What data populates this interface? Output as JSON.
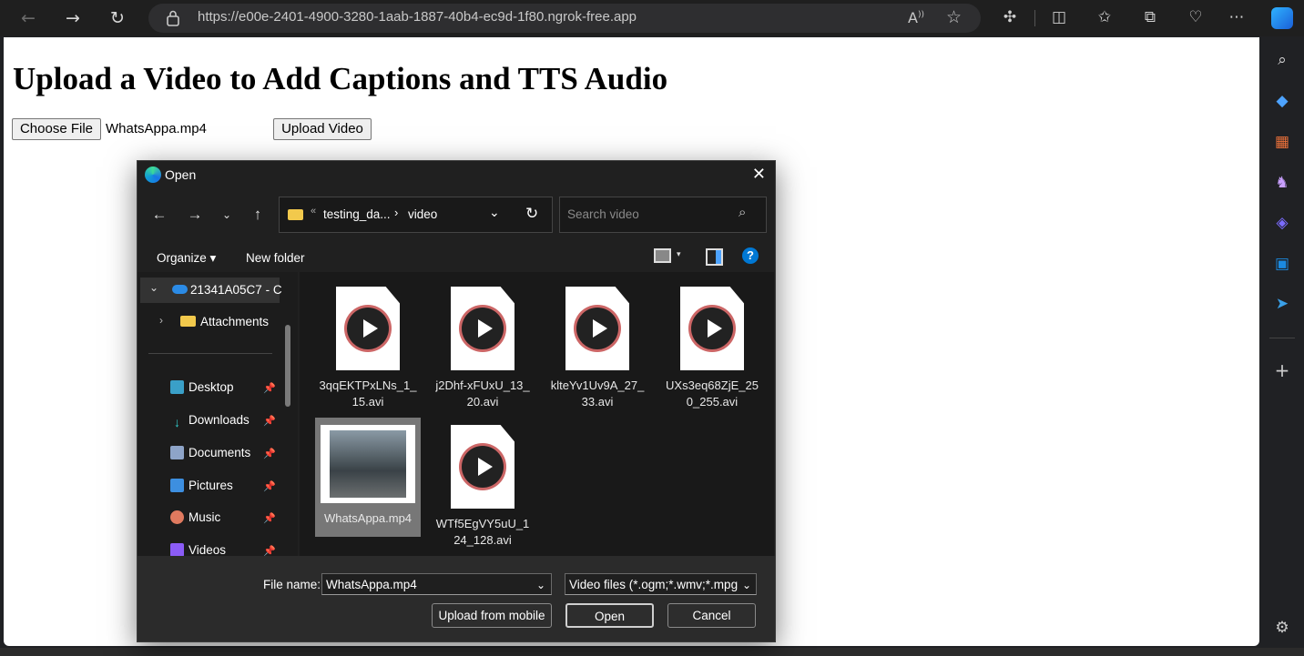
{
  "browser": {
    "url": "https://e00e-2401-4900-3280-1aab-1887-40b4-ec9d-1f80.ngrok-free.app"
  },
  "page": {
    "title": "Upload a Video to Add Captions and TTS Audio",
    "choose_file_label": "Choose File",
    "chosen_file": "WhatsAppa.mp4",
    "upload_button": "Upload Video"
  },
  "dialog": {
    "title": "Open",
    "path": {
      "parent": "testing_da...",
      "current": "video"
    },
    "search_placeholder": "Search video",
    "organize": "Organize",
    "new_folder": "New folder",
    "nav": {
      "onedrive": "21341A05C7 - C",
      "attachments": "Attachments",
      "desktop": "Desktop",
      "downloads": "Downloads",
      "documents": "Documents",
      "pictures": "Pictures",
      "music": "Music",
      "videos": "Videos"
    },
    "files": [
      {
        "line1": "3qqEKTPxLNs_1_",
        "line2": "15.avi"
      },
      {
        "line1": "j2Dhf-xFUxU_13_",
        "line2": "20.avi"
      },
      {
        "line1": "klteYv1Uv9A_27_",
        "line2": "33.avi"
      },
      {
        "line1": "UXs3eq68ZjE_25",
        "line2": "0_255.avi"
      },
      {
        "line1": "WhatsAppa.mp4",
        "line2": ""
      },
      {
        "line1": "WTf5EgVY5uU_1",
        "line2": "24_128.avi"
      }
    ],
    "file_name_label": "File name:",
    "file_name_value": "WhatsAppa.mp4",
    "file_type": "Video files (*.ogm;*.wmv;*.mpg",
    "upload_mobile": "Upload from mobile",
    "open": "Open",
    "cancel": "Cancel"
  },
  "colors": {
    "accent": "#0078d4",
    "dialog_bg": "#202020",
    "selected": "#777777"
  }
}
